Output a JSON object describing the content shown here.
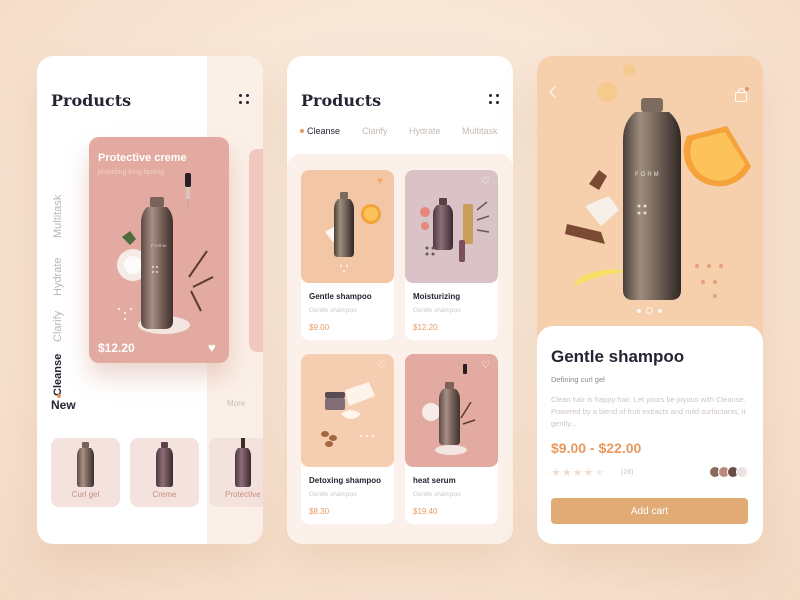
{
  "colors": {
    "accent": "#E7995E",
    "featured_card": "#E2AAA0",
    "cta": "#E1AB76",
    "dark_text": "#262433"
  },
  "screen1": {
    "title": "Products",
    "side_tabs": [
      "Multitask",
      "Hydrate",
      "Clarify",
      "Cleanse"
    ],
    "active_tab": "Cleanse",
    "featured": {
      "name": "Protective creme",
      "subtitle": "providing long-lasting",
      "price": "$12.20",
      "brand": "FORM"
    },
    "new_section": {
      "title": "New",
      "more_label": "More",
      "items": [
        "Curl gel",
        "Creme",
        "Protective"
      ]
    }
  },
  "screen2": {
    "title": "Products",
    "tabs": [
      "Cleanse",
      "Clarify",
      "Hydrate",
      "Multitask"
    ],
    "active_tab": "Cleanse",
    "products": [
      {
        "name": "Gentle shampoo",
        "subtitle": "Gentle shampoo",
        "price": "$9.00"
      },
      {
        "name": "Moisturizing",
        "subtitle": "Gentle shampoo",
        "price": "$12.20"
      },
      {
        "name": "Detoxing shampoo",
        "subtitle": "Gentle shampoo",
        "price": "$8.30"
      },
      {
        "name": "heat serum",
        "subtitle": "Gentle shampoo",
        "price": "$19.40"
      }
    ]
  },
  "screen3": {
    "brand": "FORM",
    "title": "Gentle shampoo",
    "subtitle": "Defining curl gel",
    "description": "Clean hair is happy hair. Let yours be joyous with Cleanse. Powered by a blend of fruit extracts and mild surfactants, it gently...",
    "price_range": "$9.00 - $22.00",
    "rating": 4,
    "stars": "★★★★★",
    "review_count": "(28)",
    "cta_label": "Add cart"
  }
}
